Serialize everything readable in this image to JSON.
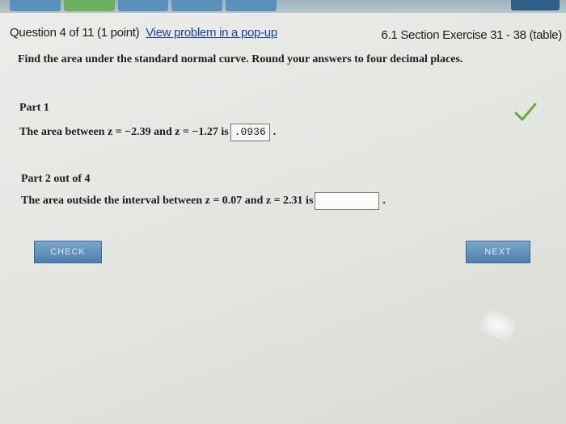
{
  "header": {
    "question": "Question 4 of 11 (1 point)",
    "popup_link": "View problem in a pop-up",
    "section": "6.1 Section Exercise 31 - 38 (table)"
  },
  "instruction": "Find the area under the standard normal curve. Round your answers to four decimal places.",
  "part1": {
    "label": "Part 1",
    "text_before": "The area between z = −2.39 and z = −1.27 is",
    "answer": ".0936",
    "text_after": ".",
    "status_icon": "checkmark-icon",
    "status_color": "#6aa845"
  },
  "part2": {
    "label": "Part 2 out of 4",
    "text_before": "The area outside the interval between z = 0.07 and z = 2.31 is",
    "answer": "",
    "text_after": "."
  },
  "buttons": {
    "check": "CHECK",
    "next": "NEXT"
  }
}
